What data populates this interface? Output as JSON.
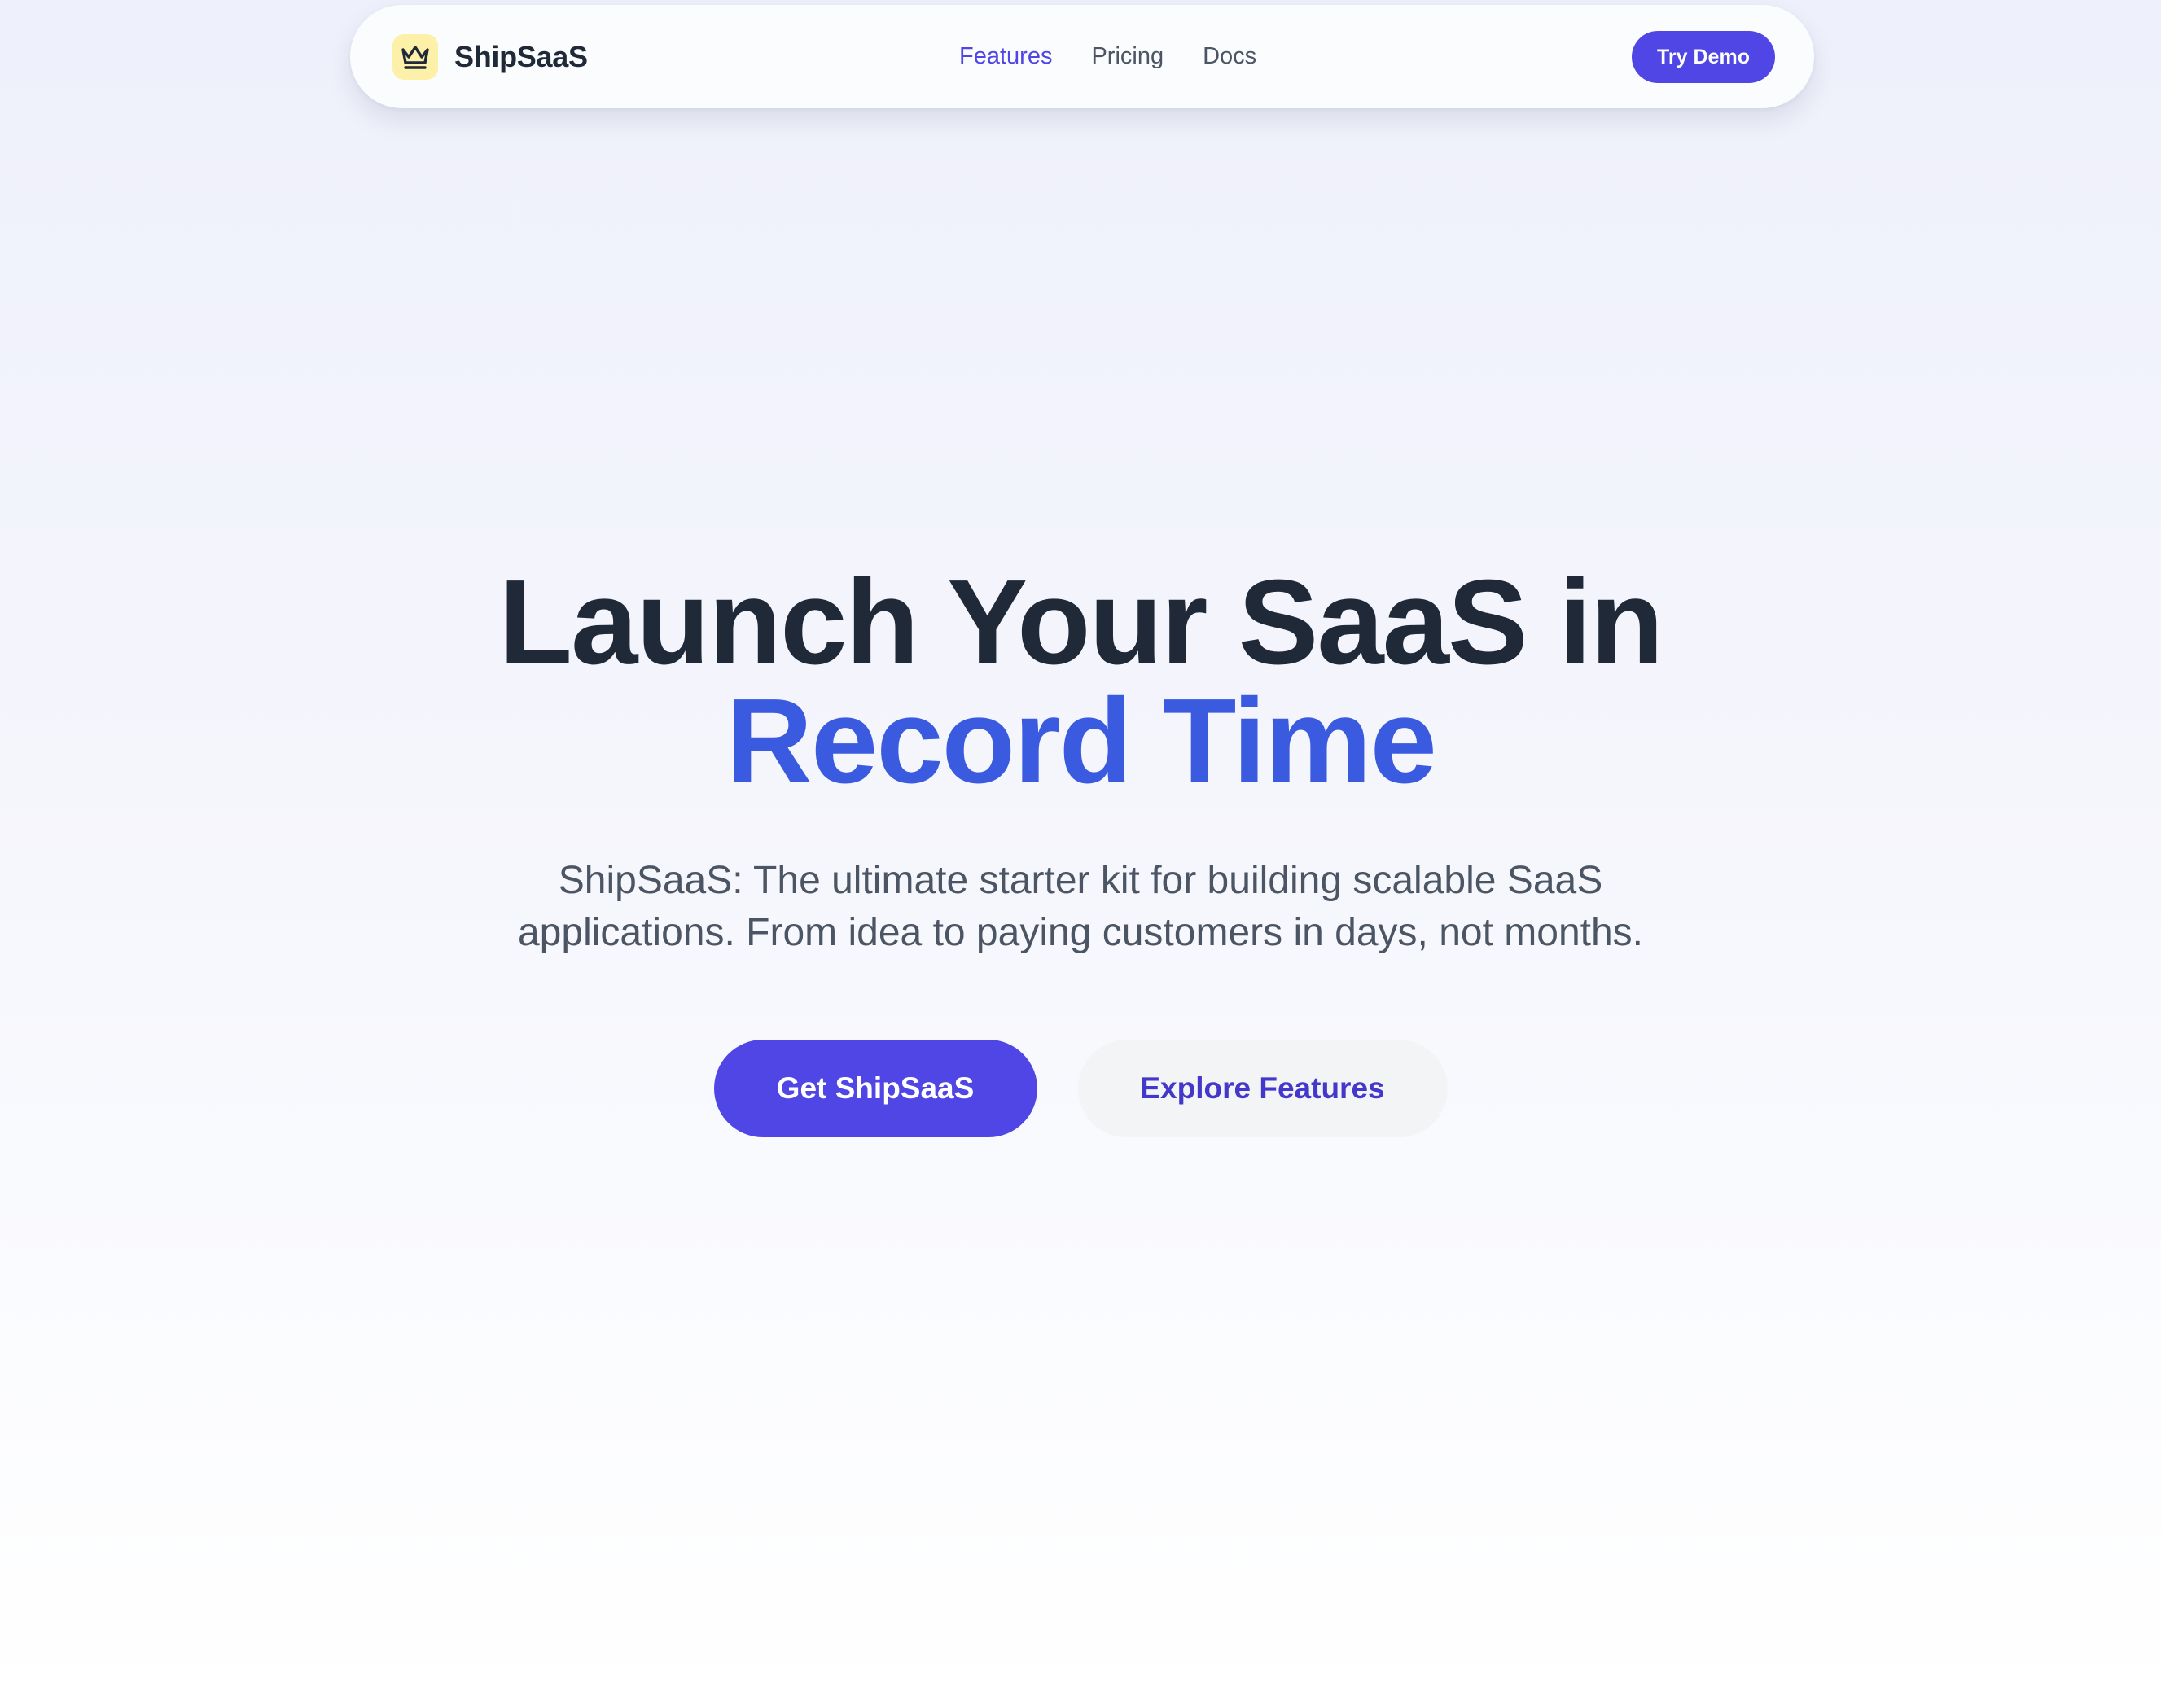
{
  "nav": {
    "brand_name": "ShipSaaS",
    "brand_icon": "crown-icon",
    "links": [
      {
        "label": "Features",
        "active": true
      },
      {
        "label": "Pricing",
        "active": false
      },
      {
        "label": "Docs",
        "active": false
      }
    ],
    "demo_button": "Try Demo"
  },
  "hero": {
    "title_line1": "Launch Your SaaS in",
    "title_line2": "Record Time",
    "subtitle_line1": "ShipSaaS: The ultimate starter kit for building scalable SaaS",
    "subtitle_line2": "applications. From idea to paying customers in days, not months.",
    "primary_cta": "Get ShipSaaS",
    "secondary_cta": "Explore Features"
  },
  "colors": {
    "primary": "#4f46e5",
    "accent_heading": "#3a5ae0",
    "icon_background": "#fdf0a8",
    "text_dark": "#1f2937",
    "text_muted": "#4b5563"
  }
}
